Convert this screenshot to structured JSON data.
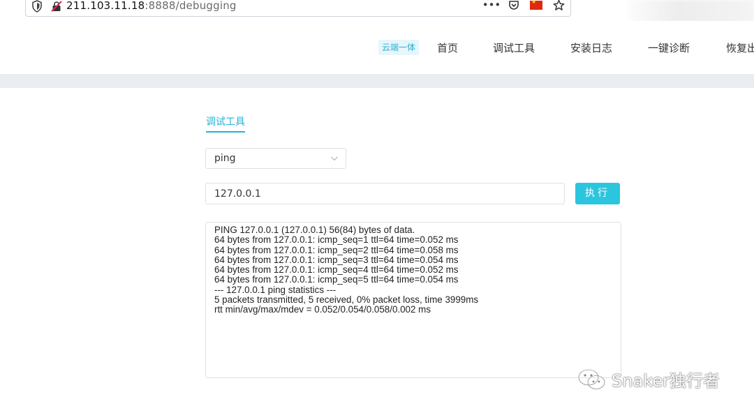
{
  "browser": {
    "url_host": "211.103.11.18",
    "url_rest": ":8888/debugging",
    "icons": [
      "shield-icon",
      "insecure-lock-icon",
      "more-icon",
      "pocket-icon",
      "china-flag-icon",
      "star-icon"
    ],
    "more_glyph": "•••"
  },
  "nav": {
    "badge": "云端一体",
    "items": [
      "首页",
      "调试工具",
      "安装日志",
      "一键诊断",
      "恢复出"
    ]
  },
  "main": {
    "tab_label": "调试工具",
    "select_value": "ping",
    "input_value": "127.0.0.1",
    "run_label": "执行",
    "output_lines": [
      "PING 127.0.0.1 (127.0.0.1) 56(84) bytes of data.",
      "64 bytes from 127.0.0.1: icmp_seq=1 ttl=64 time=0.052 ms",
      "64 bytes from 127.0.0.1: icmp_seq=2 ttl=64 time=0.058 ms",
      "64 bytes from 127.0.0.1: icmp_seq=3 ttl=64 time=0.054 ms",
      "64 bytes from 127.0.0.1: icmp_seq=4 ttl=64 time=0.052 ms",
      "64 bytes from 127.0.0.1: icmp_seq=5 ttl=64 time=0.054 ms",
      "--- 127.0.0.1 ping statistics ---",
      "5 packets transmitted, 5 received, 0% packet loss, time 3999ms",
      "rtt min/avg/max/mdev = 0.052/0.054/0.058/0.002 ms"
    ]
  },
  "watermark": {
    "text": "Snaker独行者"
  },
  "colors": {
    "accent": "#22b4d4",
    "button": "#2cc5de",
    "band": "#e9edf2"
  }
}
